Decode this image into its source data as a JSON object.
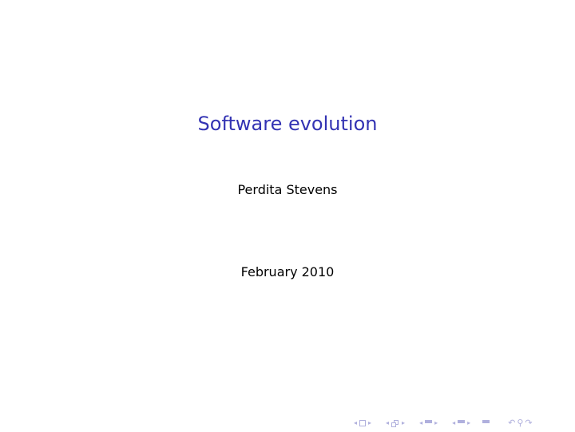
{
  "slide": {
    "title": "Software evolution",
    "author": "Perdita Stevens",
    "date": "February 2010"
  },
  "navigation": {
    "color": "#b0b0dd",
    "left_arrow": "◂",
    "right_arrow": "▸",
    "search_glyphs": [
      "↶",
      "⚲",
      "↷"
    ]
  }
}
